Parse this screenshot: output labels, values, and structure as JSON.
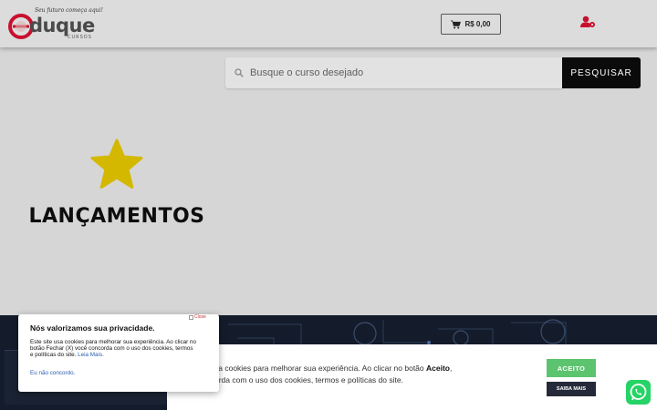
{
  "brand": {
    "tagline": "Seu futuro começa aqui!",
    "name": "duque",
    "sub": "CURSOS"
  },
  "cart": {
    "total": "R$ 0,00",
    "icon": "cart-icon"
  },
  "user": {
    "icon": "user-settings-icon"
  },
  "search": {
    "placeholder": "Busque o curso desejado",
    "button_label": "PESQUISAR",
    "icon": "search-icon"
  },
  "section": {
    "title": "LANÇAMENTOS",
    "icon": "star-icon"
  },
  "cookie_bar": {
    "text_part1": "sa cookies para melhorar sua experiência. Ao clicar no botão ",
    "text_bold": "Aceito",
    "text_part2": ",",
    "text_line2": "orda com o uso dos cookies, termos e políticas do site.",
    "accept_label": "ACEITO",
    "more_label": "SAIBA MAIS"
  },
  "privacy_popup": {
    "title": "Nós valorizamos sua privacidade.",
    "body": "Este site usa cookies para melhorar sua experiência. Ao clicar no botão Fechar (X) você concorda com o uso dos cookies, termos e políticas do site.",
    "link": "Leia Mais.",
    "decline": "Eu não concordo.",
    "close_label": "Close"
  },
  "colors": {
    "accent_star": "#d4b800",
    "search_button": "#0b0b0b",
    "accept": "#5cc36f",
    "whatsapp": "#25d366",
    "user_icon": "#c8102e"
  }
}
